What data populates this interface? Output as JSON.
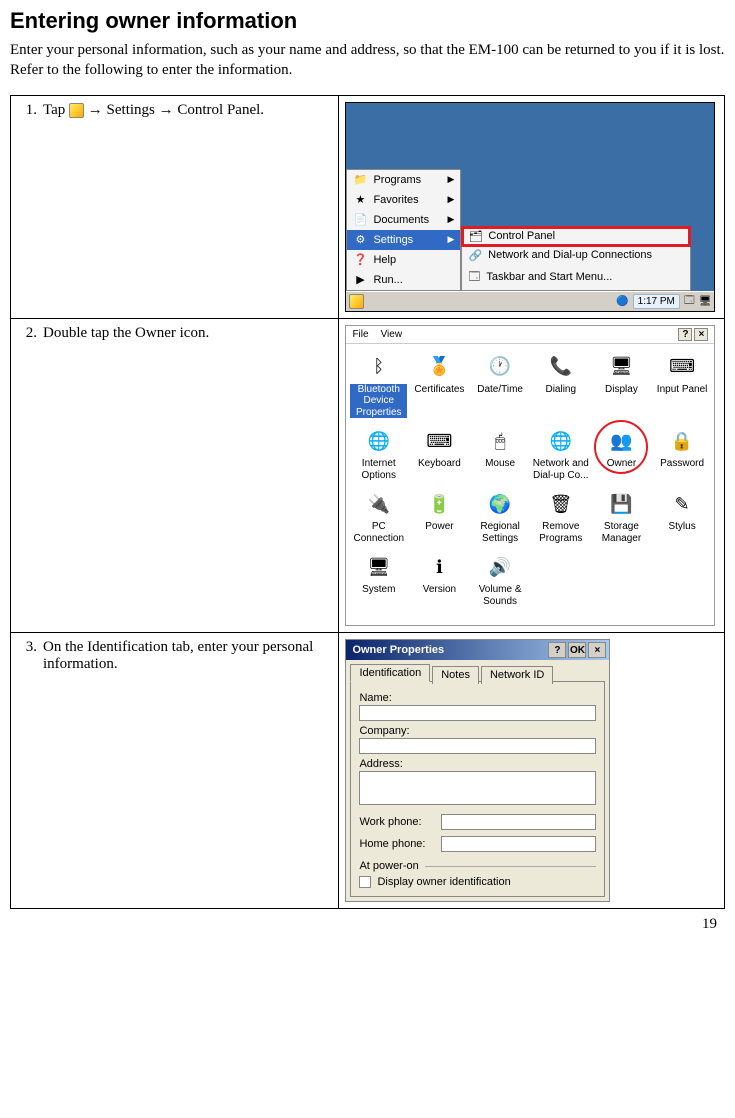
{
  "heading": "Entering owner information",
  "intro": "Enter your personal information, such as your name and address, so that the EM-100 can be returned to you if it is lost. Refer to the following to enter the information.",
  "page_number": "19",
  "steps": {
    "s1": {
      "num": "1.",
      "pre": "Tap",
      "post": " → Settings → Control Panel."
    },
    "s2": {
      "num": "2.",
      "text": "Double tap the Owner icon."
    },
    "s3": {
      "num": "3.",
      "text": "On the Identification tab, enter your personal information."
    }
  },
  "ss1": {
    "menu": {
      "programs": "Programs",
      "favorites": "Favorites",
      "documents": "Documents",
      "settings": "Settings",
      "help": "Help",
      "run": "Run..."
    },
    "submenu": {
      "control_panel": "Control Panel",
      "network": "Network and Dial-up Connections",
      "taskbar": "Taskbar and Start Menu..."
    },
    "tray": {
      "time": "1:17 PM"
    }
  },
  "ss2": {
    "menu": {
      "file": "File",
      "view": "View",
      "help": "?",
      "close": "×"
    },
    "items": {
      "bluetooth": "Bluetooth Device Properties",
      "certificates": "Certificates",
      "datetime": "Date/Time",
      "dialing": "Dialing",
      "display": "Display",
      "inputpanel": "Input Panel",
      "internet": "Internet Options",
      "keyboard": "Keyboard",
      "mouse": "Mouse",
      "network": "Network and Dial-up Co...",
      "owner": "Owner",
      "password": "Password",
      "pcconn": "PC Connection",
      "power": "Power",
      "regional": "Regional Settings",
      "remove": "Remove Programs",
      "storage": "Storage Manager",
      "stylus": "Stylus",
      "system": "System",
      "version": "Version",
      "volume": "Volume & Sounds"
    }
  },
  "ss3": {
    "title": "Owner Properties",
    "btn_help": "?",
    "btn_ok": "OK",
    "btn_close": "×",
    "tabs": {
      "identification": "Identification",
      "notes": "Notes",
      "networkid": "Network ID"
    },
    "labels": {
      "name": "Name:",
      "company": "Company:",
      "address": "Address:",
      "work_phone": "Work phone:",
      "home_phone": "Home phone:",
      "at_power_on": "At power-on",
      "display_owner": "Display owner identification"
    }
  }
}
